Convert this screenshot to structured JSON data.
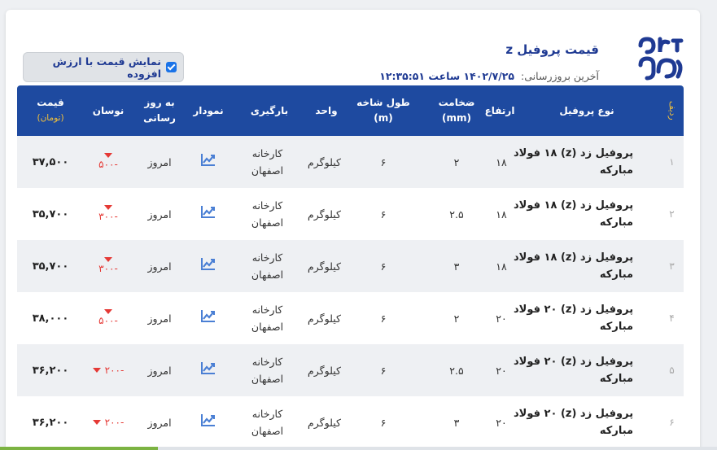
{
  "header": {
    "title": "قیمت پروفیل z",
    "updated_label": "آخرین بروزرسانی:",
    "updated_value": "۱۴۰۲/۷/۲۵ ساعت ۱۲:۳۵:۵۱",
    "vat_checkbox_label": "نمایش قیمت با ارزش افزوده",
    "vat_checked": true
  },
  "columns": {
    "index": "ردیف",
    "name": "نوع پروفیل",
    "height": "ارتفاع",
    "thickness": "ضخامت",
    "thickness_unit": "(mm)",
    "length": "طول شاخه",
    "length_unit": "(m)",
    "unit": "واحد",
    "loading": "بارگیری",
    "chart": "نمودار",
    "updated": "به روز",
    "updated2": "رسانی",
    "fluct": "نوسان",
    "price": "قیمت",
    "price_unit": "(تومان)"
  },
  "rows": [
    {
      "index": "۱",
      "name1": "پروفیل زد (z) ۱۸ فولاد",
      "name2": "مبارکه",
      "height": "۱۸",
      "thickness": "۲",
      "length": "۶",
      "unit": "کیلوگرم",
      "loading1": "کارخانه",
      "loading2": "اصفهان",
      "updated": "امروز",
      "fluct": "-۵۰۰",
      "price": "۳۷,۵۰۰"
    },
    {
      "index": "۲",
      "name1": "پروفیل زد (z) ۱۸ فولاد",
      "name2": "مبارکه",
      "height": "۱۸",
      "thickness": "۲.۵",
      "length": "۶",
      "unit": "کیلوگرم",
      "loading1": "کارخانه",
      "loading2": "اصفهان",
      "updated": "امروز",
      "fluct": "-۳۰۰",
      "price": "۳۵,۷۰۰"
    },
    {
      "index": "۳",
      "name1": "پروفیل زد (z) ۱۸ فولاد",
      "name2": "مبارکه",
      "height": "۱۸",
      "thickness": "۳",
      "length": "۶",
      "unit": "کیلوگرم",
      "loading1": "کارخانه",
      "loading2": "اصفهان",
      "updated": "امروز",
      "fluct": "-۳۰۰",
      "price": "۳۵,۷۰۰"
    },
    {
      "index": "۴",
      "name1": "پروفیل زد (z) ۲۰ فولاد",
      "name2": "مبارکه",
      "height": "۲۰",
      "thickness": "۲",
      "length": "۶",
      "unit": "کیلوگرم",
      "loading1": "کارخانه",
      "loading2": "اصفهان",
      "updated": "امروز",
      "fluct": "-۵۰۰",
      "price": "۳۸,۰۰۰"
    },
    {
      "index": "۵",
      "name1": "پروفیل زد (z) ۲۰ فولاد",
      "name2": "مبارکه",
      "height": "۲۰",
      "thickness": "۲.۵",
      "length": "۶",
      "unit": "کیلوگرم",
      "loading1": "کارخانه",
      "loading2": "اصفهان",
      "updated": "امروز",
      "fluct": "-۲۰۰",
      "price": "۳۶,۲۰۰"
    },
    {
      "index": "۶",
      "name1": "پروفیل زد (z) ۲۰ فولاد",
      "name2": "مبارکه",
      "height": "۲۰",
      "thickness": "۳",
      "length": "۶",
      "unit": "کیلوگرم",
      "loading1": "کارخانه",
      "loading2": "اصفهان",
      "updated": "امروز",
      "fluct": "-۲۰۰",
      "price": "۳۶,۲۰۰"
    }
  ],
  "icons": {
    "chart": "trend-chart-icon",
    "fluct": "down-triangle-icon",
    "logo": "brand-logo"
  },
  "colors": {
    "header_bg": "#1e4aa0",
    "accent": "#f3c13a",
    "down": "#e53935",
    "chart_icon": "#4a7fd4",
    "logo": "#1f3a93"
  }
}
